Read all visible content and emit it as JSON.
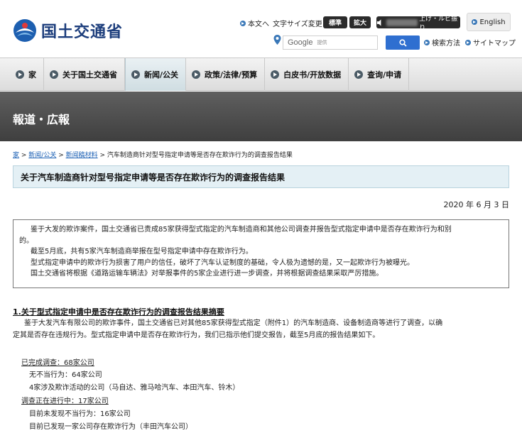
{
  "header": {
    "logo_text": "国土交通省",
    "links": {
      "honbun": "本文へ",
      "font_size": "文字サイズ変更",
      "standard": "標準",
      "large": "拡大",
      "ruby": "上げ・ルビ振り",
      "english": "English",
      "search_method": "検索方法",
      "sitemap": "サイトマップ"
    },
    "search": {
      "brand": "Google",
      "placeholder": "提供"
    }
  },
  "nav": {
    "items": [
      {
        "label": "家",
        "active": false
      },
      {
        "label": "关于国土交通省",
        "active": false
      },
      {
        "label": "新闻/公关",
        "active": true
      },
      {
        "label": "政策/法律/预算",
        "active": false
      },
      {
        "label": "白皮书/开放数据",
        "active": false
      },
      {
        "label": "查询/申请",
        "active": false
      }
    ]
  },
  "banner": {
    "title": "報道・広報"
  },
  "breadcrumb": {
    "items": [
      "家",
      "新闻/公关",
      "新闻稿材料"
    ],
    "current": "汽车制造商针对型号指定申请等是否存在欺诈行为的调查报告结果"
  },
  "page": {
    "title": "关于汽车制造商针对型号指定申请等是否存在欺诈行为的调查报告结果",
    "date": "2020 年 6 月 3 日"
  },
  "summary": {
    "p1": "鉴于大发的欺诈案件，国土交通省已责成85家获得型式指定的汽车制造商和其他公司调查并报告型式指定申请中是否存在欺诈行为和别",
    "p1_cont": "的。",
    "p2": "截至5月底，共有5家汽车制造商举报在型号指定申请中存在欺诈行为。",
    "p3": "型式指定申请中的欺诈行为损害了用户的信任，破坏了汽车认证制度的基础，令人极为遗憾的是，又一起欺诈行为被曝光。",
    "p4": "国土交通省将根据《道路运输车辆法》对举报事件的5家企业进行进一步调查，并将根据调查结果采取严厉措施。"
  },
  "section": {
    "heading": "1.关于型式指定申请中是否存在欺诈行为的调查报告结果摘要",
    "line1": "鉴于大发汽车有限公司的欺诈事件，国土交通省已对其他85家获得型式指定（附件1）的汽车制造商、设备制造商等进行了调查，以确",
    "line2": "定其是否存在违规行为。型式指定申请中是否存在欺诈行为，我们已指示他们提交报告，截至5月底的报告结果如下。"
  },
  "stats": {
    "completed": "已完成调查：68家公司",
    "no_misconduct": "无不当行为：64家公司",
    "fraud_companies": "4家涉及欺诈活动的公司（马自达、雅马哈汽车、本田汽车、铃木）",
    "in_progress": "调查正在进行中：17家公司",
    "not_found": "目前未发现不当行为：16家公司",
    "found": "目前已发现一家公司存在欺诈行为（丰田汽车公司）"
  },
  "colors": {
    "brand_blue": "#1d3e7c",
    "link_blue": "#1a5fb4",
    "search_blue": "#2f6fd0",
    "banner": "#4a4a4a",
    "title_bg": "#e4f0f5"
  }
}
